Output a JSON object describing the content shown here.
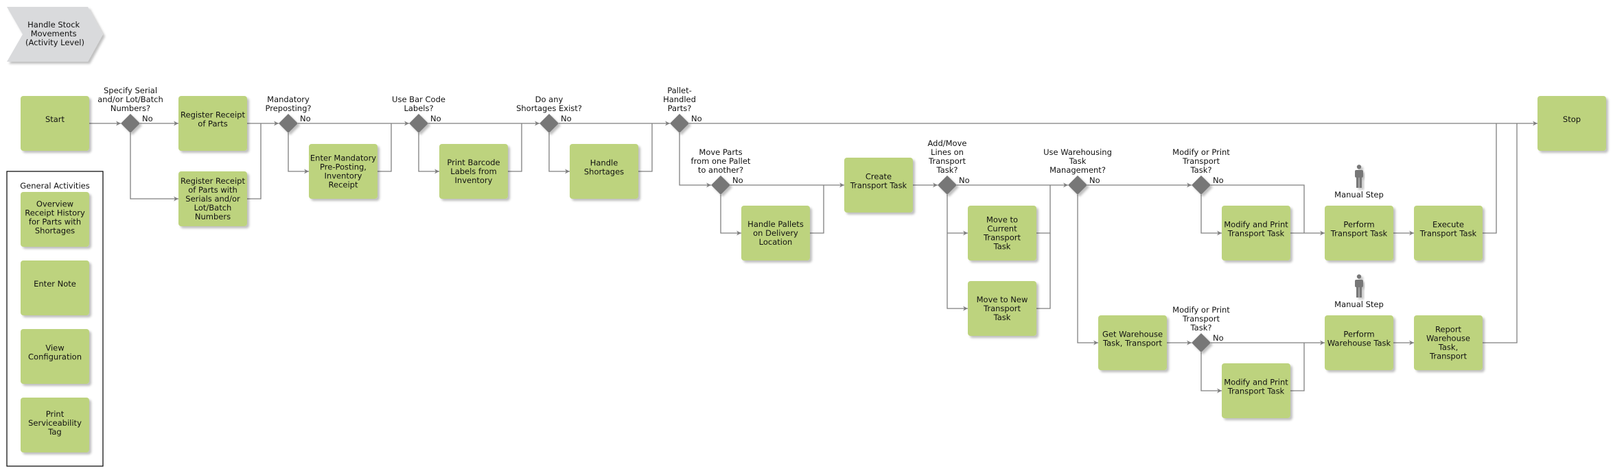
{
  "diagram": {
    "title": "Handle Stock Movements (Activity Level)",
    "title_lines": [
      "Handle Stock",
      "Movements",
      "(Activity Level)"
    ],
    "colors": {
      "activity": "#bdd37e",
      "decision": "#777777",
      "edge": "#7f7f7f",
      "header": "#d9dadc",
      "actor": "#777777"
    },
    "nodes": [
      {
        "id": "start",
        "type": "activity",
        "lines": [
          "Start"
        ]
      },
      {
        "id": "d_serial",
        "type": "decision",
        "question": [
          "Specify Serial",
          "and/or Lot/Batch",
          "Numbers?"
        ],
        "no_label": "No"
      },
      {
        "id": "register_receipt",
        "type": "activity",
        "lines": [
          "Register Receipt",
          "of Parts"
        ]
      },
      {
        "id": "register_serials",
        "type": "activity",
        "lines": [
          "Register Receipt",
          "of Parts with",
          "Serials and/or",
          "Lot/Batch",
          "Numbers"
        ]
      },
      {
        "id": "d_preposting",
        "type": "decision",
        "question": [
          "Mandatory",
          "Preposting?"
        ],
        "no_label": "No"
      },
      {
        "id": "enter_preposting",
        "type": "activity",
        "lines": [
          "Enter Mandatory",
          "Pre-Posting,",
          "Inventory",
          "Receipt"
        ]
      },
      {
        "id": "d_barcode",
        "type": "decision",
        "question": [
          "Use Bar Code",
          "Labels?"
        ],
        "no_label": "No"
      },
      {
        "id": "print_barcode",
        "type": "activity",
        "lines": [
          "Print Barcode",
          "Labels from",
          "Inventory"
        ]
      },
      {
        "id": "d_shortages",
        "type": "decision",
        "question": [
          "Do any",
          "Shortages Exist?"
        ],
        "no_label": "No"
      },
      {
        "id": "handle_shortages",
        "type": "activity",
        "lines": [
          "Handle",
          "Shortages"
        ]
      },
      {
        "id": "d_pallet",
        "type": "decision",
        "question": [
          "Pallet-",
          "Handled",
          "Parts?"
        ],
        "no_label": "No"
      },
      {
        "id": "d_move_parts",
        "type": "decision",
        "question": [
          "Move Parts",
          "from one Pallet",
          "to another?"
        ],
        "no_label": "No"
      },
      {
        "id": "handle_pallets",
        "type": "activity",
        "lines": [
          "Handle Pallets",
          "on Delivery",
          "Location"
        ]
      },
      {
        "id": "create_transport",
        "type": "activity",
        "lines": [
          "Create",
          "Transport Task"
        ]
      },
      {
        "id": "d_add_move",
        "type": "decision",
        "question": [
          "Add/Move",
          "Lines on",
          "Transport",
          "Task?"
        ],
        "no_label": "No"
      },
      {
        "id": "move_current",
        "type": "activity",
        "lines": [
          "Move to",
          "Current",
          "Transport",
          "Task"
        ]
      },
      {
        "id": "move_new",
        "type": "activity",
        "lines": [
          "Move to New",
          "Transport",
          "Task"
        ]
      },
      {
        "id": "d_warehousing",
        "type": "decision",
        "question": [
          "Use Warehousing",
          "Task",
          "Management?"
        ],
        "no_label": "No"
      },
      {
        "id": "d_modify1",
        "type": "decision",
        "question": [
          "Modify or Print",
          "Transport",
          "Task?"
        ],
        "no_label": "No"
      },
      {
        "id": "modify_print1",
        "type": "activity",
        "lines": [
          "Modify and Print",
          "Transport Task"
        ]
      },
      {
        "id": "perform_transport",
        "type": "activity",
        "lines": [
          "Perform",
          "Transport Task"
        ],
        "actor_label": "Manual Step"
      },
      {
        "id": "execute_transport",
        "type": "activity",
        "lines": [
          "Execute",
          "Transport Task"
        ]
      },
      {
        "id": "get_warehouse",
        "type": "activity",
        "lines": [
          "Get Warehouse",
          "Task, Transport"
        ]
      },
      {
        "id": "d_modify2",
        "type": "decision",
        "question": [
          "Modify or Print",
          "Transport",
          "Task?"
        ],
        "no_label": "No"
      },
      {
        "id": "modify_print2",
        "type": "activity",
        "lines": [
          "Modify and Print",
          "Transport Task"
        ]
      },
      {
        "id": "perform_warehouse",
        "type": "activity",
        "lines": [
          "Perform",
          "Warehouse Task"
        ],
        "actor_label": "Manual Step"
      },
      {
        "id": "report_warehouse",
        "type": "activity",
        "lines": [
          "Report",
          "Warehouse",
          "Task,",
          "Transport"
        ]
      },
      {
        "id": "stop",
        "type": "activity",
        "lines": [
          "Stop"
        ]
      }
    ],
    "general_activities": {
      "title": "General Activities",
      "items": [
        {
          "lines": [
            "Overview",
            "Receipt History",
            "for Parts with",
            "Shortages"
          ]
        },
        {
          "lines": [
            "Enter Note"
          ]
        },
        {
          "lines": [
            "View",
            "Configuration"
          ]
        },
        {
          "lines": [
            "Print",
            "Serviceability",
            "Tag"
          ]
        }
      ]
    }
  }
}
